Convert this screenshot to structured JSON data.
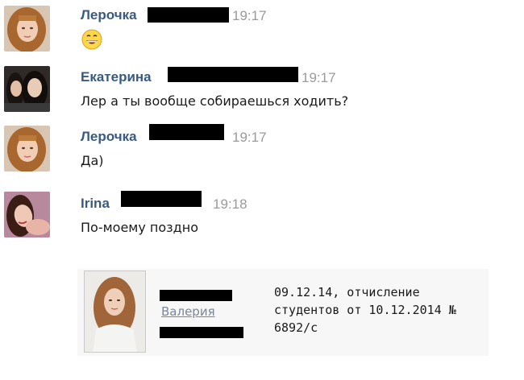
{
  "messages": [
    {
      "author": "Лерочка",
      "time": "19:17",
      "text": "",
      "emoji": "grinning-emoji"
    },
    {
      "author": "Екатерина",
      "time": "19:17",
      "text": "Лер а ты вообще собираешься ходить?"
    },
    {
      "author": "Лерочка",
      "time": "19:17",
      "text": "Да)"
    },
    {
      "author": "Irina",
      "time": "19:18",
      "text": "По-моему поздно"
    }
  ],
  "attachment": {
    "name_link": "Валерия",
    "text": "09.12.14, отчисление студентов от 10.12.2014 № 6892/c"
  },
  "colors": {
    "author": "#3b5a80",
    "time": "#9a9a9a",
    "link": "#7a8797"
  }
}
